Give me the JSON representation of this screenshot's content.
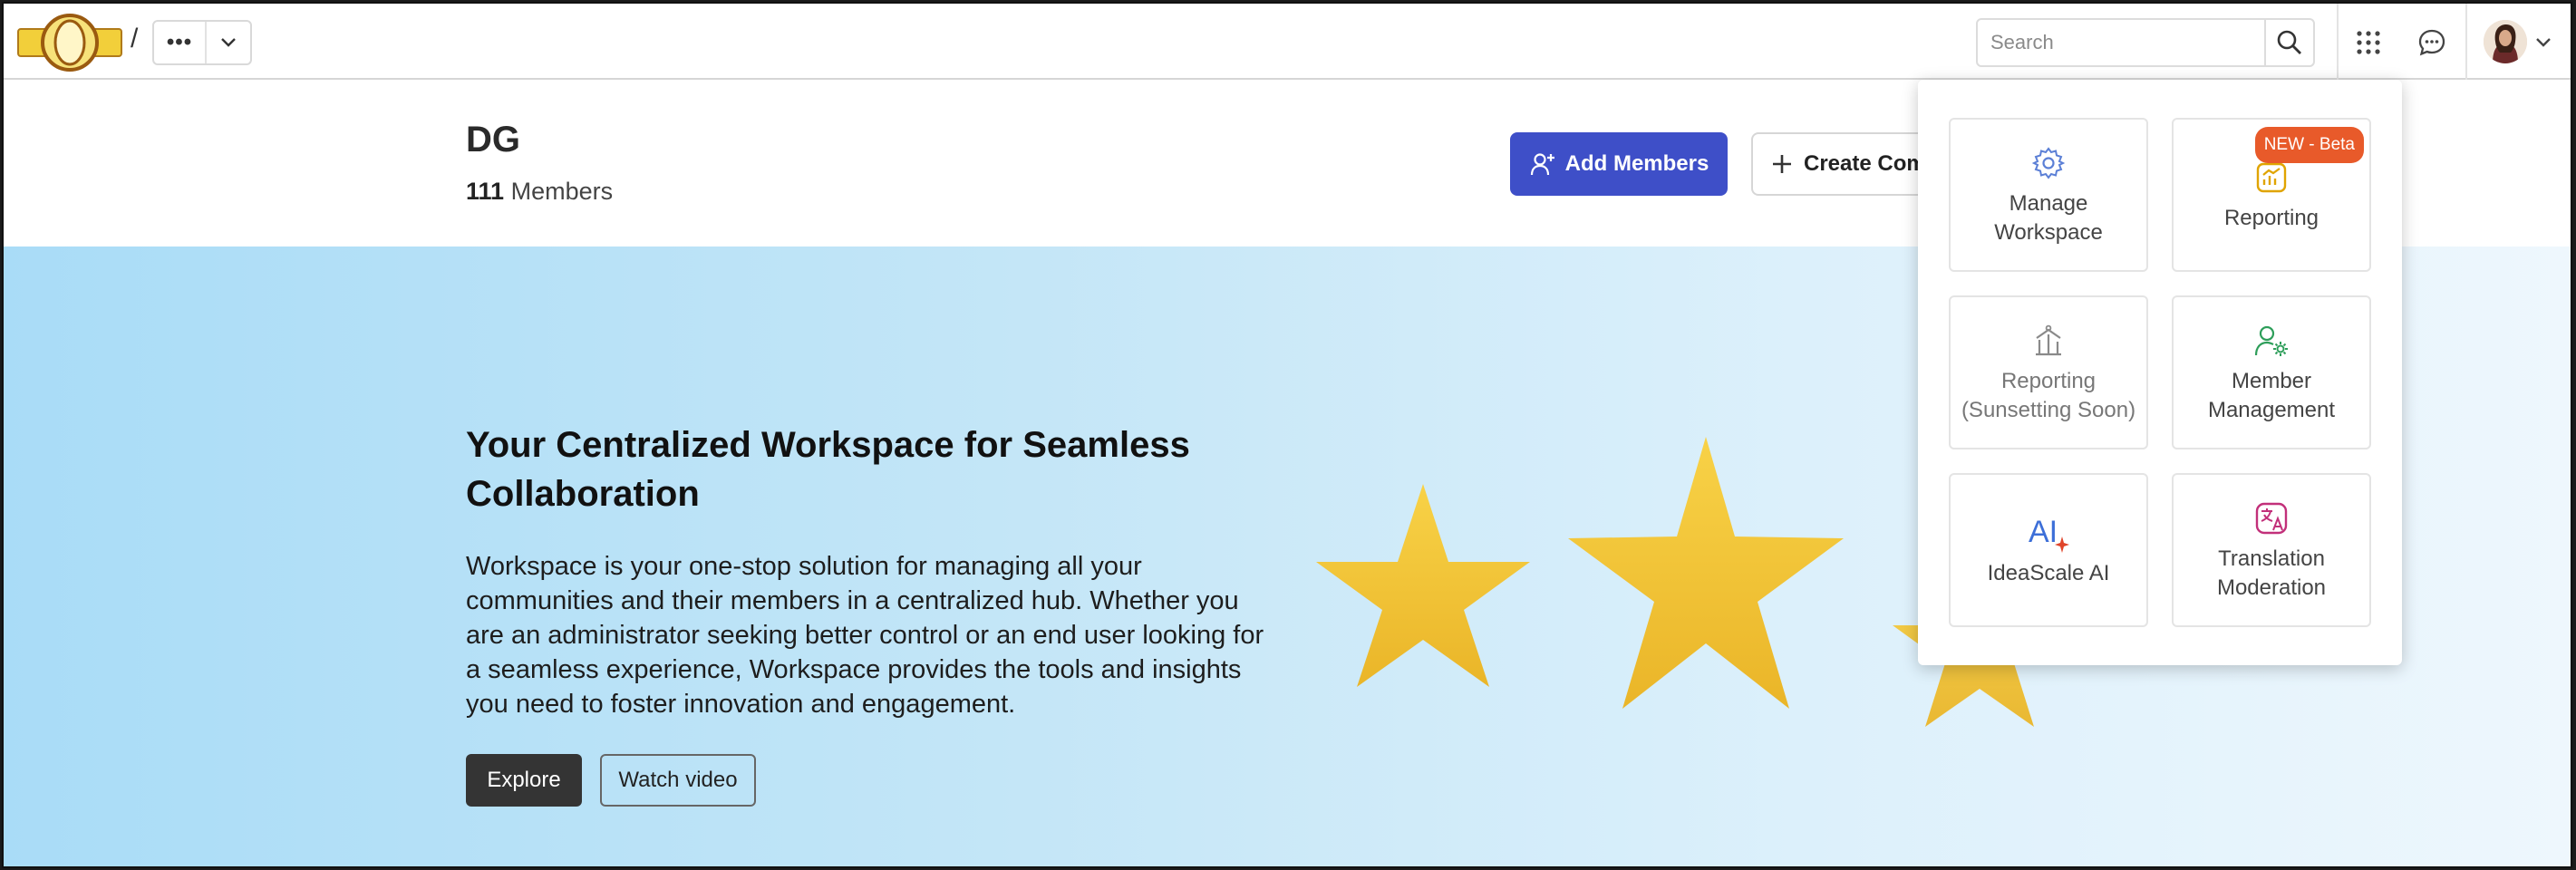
{
  "topbar": {
    "breadcrumb_separator": "/",
    "more_menu_label": "•••",
    "search": {
      "placeholder": "Search",
      "value": ""
    }
  },
  "header": {
    "title": "DG",
    "member_count": "111",
    "member_label": "Members",
    "add_members_label": "Add Members",
    "create_label": "Create Community"
  },
  "hero": {
    "title": "Your Centralized Workspace for Seamless Collaboration",
    "body": "Workspace is your one-stop solution for managing all your communities and their members in a centralized hub. Whether you are an administrator seeking better control or an end user looking for a seamless experience, Workspace provides the tools and insights you need to foster innovation and engagement.",
    "explore_label": "Explore",
    "watch_label": "Watch video"
  },
  "apps_menu": {
    "tiles": [
      {
        "label": "Manage Workspace",
        "icon": "gear-icon",
        "color": "#5b7fd6"
      },
      {
        "label": "Reporting",
        "icon": "report-chart-icon",
        "color": "#e0a400",
        "badge": "NEW - Beta"
      },
      {
        "label": "Reporting (Sunsetting Soon)",
        "icon": "reporting-legacy-icon",
        "color": "#8a8a8a"
      },
      {
        "label": "Member Management",
        "icon": "member-settings-icon",
        "color": "#2e9e5a"
      },
      {
        "label": "IdeaScale AI",
        "icon": "ai-sparkle-icon",
        "color": "#3d6fd8"
      },
      {
        "label": "Translation Moderation",
        "icon": "translate-icon",
        "color": "#c2307a"
      }
    ]
  },
  "colors": {
    "primary": "#3e4fc8",
    "badge": "#e85a2a",
    "hero_start": "#a9dcf7",
    "hero_end": "#eef7fd"
  }
}
